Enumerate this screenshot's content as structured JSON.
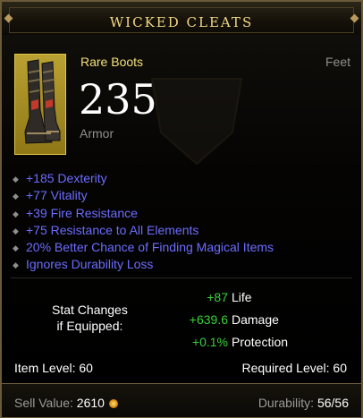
{
  "tooltip": {
    "title": "WICKED CLEATS",
    "item_type": "Rare Boots",
    "slot": "Feet",
    "armor_value": "235",
    "armor_label": "Armor",
    "affixes": [
      "+185 Dexterity",
      "+77 Vitality",
      "+39 Fire Resistance",
      "+75 Resistance to All Elements",
      "20% Better Chance of Finding Magical Items",
      "Ignores Durability Loss"
    ],
    "stat_changes": {
      "heading_line1": "Stat Changes",
      "heading_line2": "if Equipped:",
      "rows": [
        {
          "value": "+87",
          "name": "Life"
        },
        {
          "value": "+639.6",
          "name": "Damage"
        },
        {
          "value": "+0.1%",
          "name": "Protection"
        }
      ]
    },
    "item_level": "Item Level: 60",
    "required_level": "Required Level: 60",
    "sell_label": "Sell Value:",
    "sell_value": "2610",
    "durability_label": "Durability:",
    "durability_value": "56/56",
    "icons": {
      "portrait": "boots-icon",
      "gold": "gold-coin-icon",
      "affix_bullet": "diamond-bullet-icon"
    },
    "colors": {
      "title": "#f0d784",
      "rare": "#f3e17a",
      "affix": "#6c6cff",
      "gain": "#39d139"
    }
  }
}
